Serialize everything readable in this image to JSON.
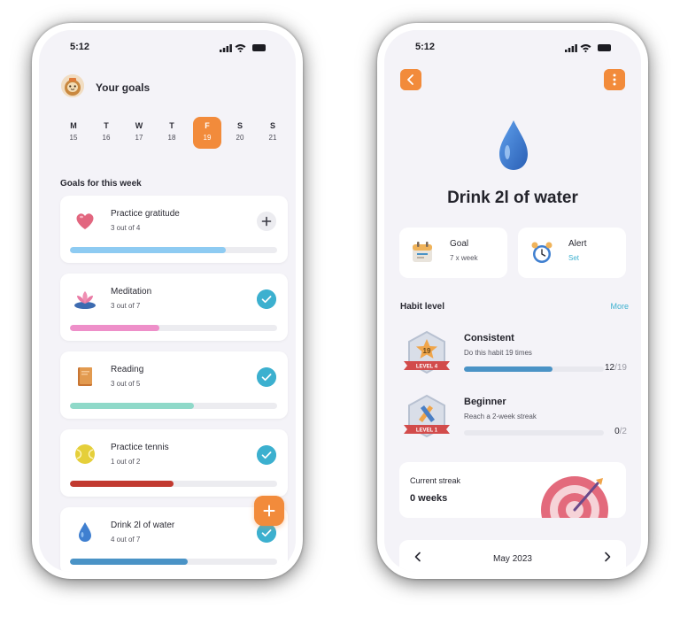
{
  "left_screen": {
    "status_time": "5:12",
    "header_title": "Your goals",
    "week_days": [
      {
        "letter": "M",
        "num": "15",
        "active": false
      },
      {
        "letter": "T",
        "num": "16",
        "active": false
      },
      {
        "letter": "W",
        "num": "17",
        "active": false
      },
      {
        "letter": "T",
        "num": "18",
        "active": false
      },
      {
        "letter": "F",
        "num": "19",
        "active": true
      },
      {
        "letter": "S",
        "num": "20",
        "active": false
      },
      {
        "letter": "S",
        "num": "21",
        "active": false
      }
    ],
    "section_title": "Goals for this week",
    "goals": [
      {
        "name": "Practice gratitude",
        "count": "3 out of 4",
        "progress": 0.75,
        "status": "add",
        "color": "#8ecbf2",
        "icon": "heart-icon"
      },
      {
        "name": "Meditation",
        "count": "3 out of 7",
        "progress": 0.43,
        "status": "done",
        "color": "#ee8fc9",
        "icon": "lotus-icon"
      },
      {
        "name": "Reading",
        "count": "3 out of 5",
        "progress": 0.6,
        "status": "done",
        "color": "#8fd9c9",
        "icon": "book-icon"
      },
      {
        "name": "Practice tennis",
        "count": "1 out of 2",
        "progress": 0.5,
        "status": "done",
        "color": "#c23a30",
        "icon": "tennis-ball-icon"
      },
      {
        "name": "Drink 2l of water",
        "count": "4 out of 7",
        "progress": 0.57,
        "status": "done",
        "color": "#4a93c6",
        "icon": "water-drop-icon"
      }
    ]
  },
  "right_screen": {
    "status_time": "5:12",
    "title": "Drink 2l of water",
    "goal_label": "Goal",
    "goal_value": "7 x week",
    "alert_label": "Alert",
    "alert_value": "Set",
    "habit_level_title": "Habit level",
    "more_label": "More",
    "levels": [
      {
        "name": "Consistent",
        "description": "Do this habit 19 times",
        "current": "12",
        "total": "/19",
        "progress": 0.63,
        "badge_text": "LEVEL 4",
        "badge_num": "19",
        "icon": "level-4-badge-icon"
      },
      {
        "name": "Beginner",
        "description": "Reach a 2-week streak",
        "current": "0",
        "total": "/2",
        "progress": 0,
        "badge_text": "LEVEL 1",
        "badge_num": "",
        "icon": "level-1-badge-icon"
      }
    ],
    "streak_label": "Current streak",
    "streak_value": "0 weeks",
    "month_label": "May 2023"
  },
  "colors": {
    "accent": "#f28b3b",
    "check": "#3cb0cf",
    "background": "#f4f3f8"
  }
}
